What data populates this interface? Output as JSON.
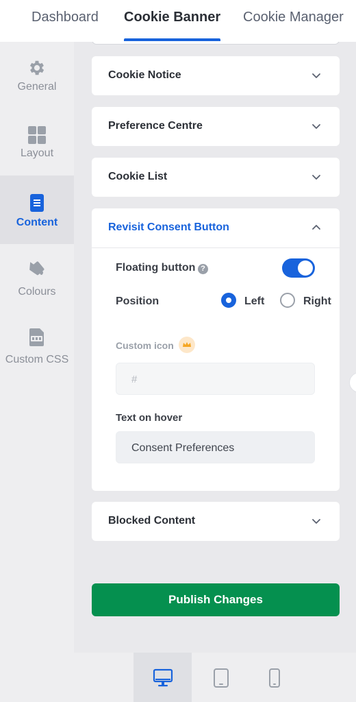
{
  "tabs": [
    {
      "label": "Dashboard"
    },
    {
      "label": "Cookie Banner",
      "active": true
    },
    {
      "label": "Cookie Manager"
    }
  ],
  "sidebar": {
    "items": [
      {
        "label": "General",
        "icon": "gear-icon"
      },
      {
        "label": "Layout",
        "icon": "grid-icon"
      },
      {
        "label": "Content",
        "icon": "document-icon",
        "active": true
      },
      {
        "label": "Colours",
        "icon": "paint-bucket-icon"
      },
      {
        "label": "Custom CSS",
        "icon": "css-file-icon"
      }
    ]
  },
  "sections": [
    {
      "title": "Cookie Notice",
      "expanded": false
    },
    {
      "title": "Preference Centre",
      "expanded": false
    },
    {
      "title": "Cookie List",
      "expanded": false
    },
    {
      "title": "Revisit Consent Button",
      "expanded": true
    },
    {
      "title": "Blocked Content",
      "expanded": false
    }
  ],
  "revisit": {
    "floating_label": "Floating button",
    "help_glyph": "?",
    "floating_enabled": true,
    "position_label": "Position",
    "position_options": [
      "Left",
      "Right"
    ],
    "position_selected": "Left",
    "custom_icon_label": "Custom icon",
    "custom_icon_placeholder": "#",
    "hover_label": "Text on hover",
    "hover_value": "Consent Preferences"
  },
  "publish_label": "Publish Changes",
  "devices": [
    {
      "name": "desktop",
      "active": true
    },
    {
      "name": "tablet",
      "active": false
    },
    {
      "name": "mobile",
      "active": false
    }
  ],
  "colors": {
    "accent": "#1863dc",
    "publish": "#05904f",
    "premium": "#f5a623"
  }
}
